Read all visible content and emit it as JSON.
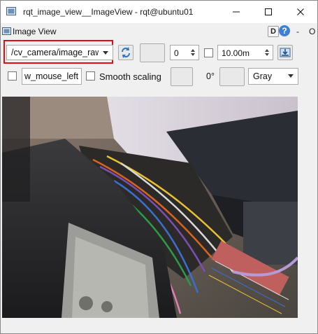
{
  "window": {
    "title": "rqt_image_view__ImageView - rqt@ubuntu01",
    "minimize_glyph": "—",
    "maximize_glyph": "☐",
    "close_glyph": "✕"
  },
  "plugin": {
    "title": "Image View",
    "d_button": "D",
    "help_glyph": "?",
    "dash_label": "-",
    "o_label": "O"
  },
  "toolbar": {
    "topic": "/cv_camera/image_raw",
    "number_value": "0",
    "time_value": "10.00m",
    "mouse_topic": "w_mouse_left",
    "smooth_scaling_label": "Smooth scaling",
    "smooth_scaling_checked": false,
    "rotation": "0°",
    "color_scheme": "Gray"
  },
  "colors": {
    "highlight": "#e01010",
    "help": "#3f7fd4"
  },
  "icons": [
    "app-icon",
    "refresh-icon",
    "save-image-icon",
    "help-icon",
    "minimize-icon",
    "maximize-icon",
    "close-icon"
  ]
}
